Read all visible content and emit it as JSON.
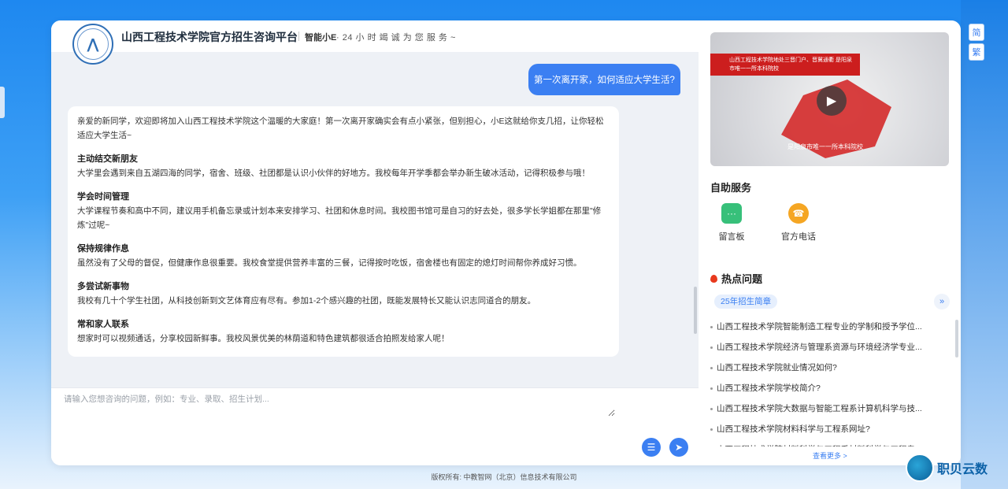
{
  "header": {
    "title": "山西工程技术学院官方招生咨询平台",
    "assistant_name": "智能小E",
    "tagline": "· 24 小 时 竭 诚 为 您 服 务 ~"
  },
  "chat": {
    "user_message": "第一次离开家，如何适应大学生活?",
    "bot_intro": "亲爱的新同学，欢迎即将加入山西工程技术学院这个温暖的大家庭！第一次离开家确实会有点小紧张，但别担心，小E这就给你支几招，让你轻松适应大学生活~",
    "sections": [
      {
        "title": "主动结交新朋友",
        "body": "大学里会遇到来自五湖四海的同学，宿舍、班级、社团都是认识小伙伴的好地方。我校每年开学季都会举办新生破冰活动，记得积极参与哦！"
      },
      {
        "title": "学会时间管理",
        "body": "大学课程节奏和高中不同，建议用手机备忘录或计划本来安排学习、社团和休息时间。我校图书馆可是自习的好去处，很多学长学姐都在那里\"修炼\"过呢~"
      },
      {
        "title": "保持规律作息",
        "body": "虽然没有了父母的督促，但健康作息很重要。我校食堂提供营养丰富的三餐，记得按时吃饭，宿舍楼也有固定的熄灯时间帮你养成好习惯。"
      },
      {
        "title": "多尝试新事物",
        "body": "我校有几十个学生社团，从科技创新到文艺体育应有尽有。参加1-2个感兴趣的社团，既能发展特长又能认识志同道合的朋友。"
      },
      {
        "title": "常和家人联系",
        "body": "想家时可以视频通话，分享校园新鲜事。我校风景优美的林荫道和特色建筑都很适合拍照发给家人呢！"
      }
    ]
  },
  "input": {
    "placeholder": "请输入您想咨询的问题，例如：专业、录取、招生计划..."
  },
  "video": {
    "banner": "山西工程技术学院地处三晋门户、晋冀通衢 是阳泉市唯一一所本科院校",
    "caption": "是阳泉市唯一一所本科院校"
  },
  "self_service": {
    "title": "自助服务",
    "items": [
      {
        "label": "留言板",
        "icon": "message-board-icon"
      },
      {
        "label": "官方电话",
        "icon": "phone-icon"
      }
    ]
  },
  "hot": {
    "title": "热点问题",
    "tag": "25年招生简章",
    "questions": [
      "山西工程技术学院智能制造工程专业的学制和授予学位...",
      "山西工程技术学院经济与管理系资源与环境经济学专业...",
      "山西工程技术学院就业情况如何?",
      "山西工程技术学院学校简介?",
      "山西工程技术学院大数据与智能工程系计算机科学与技...",
      "山西工程技术学院材料科学与工程系网址?",
      "山西工程技术学院材料科学与工程系材料科学与工程专..."
    ],
    "see_more": "查看更多 >"
  },
  "lang": {
    "simplified": "简",
    "traditional": "繁"
  },
  "footer": "版权所有: 中教智网（北京）信息技术有限公司",
  "watermark": "职贝云数",
  "colors": {
    "primary": "#3b7ff2",
    "page_bg": "#1e88f0"
  }
}
